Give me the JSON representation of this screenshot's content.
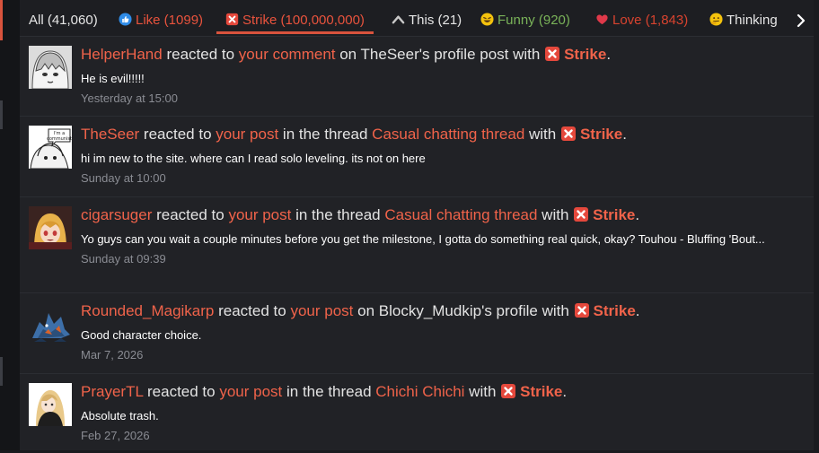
{
  "tabs": [
    {
      "label": "All (41,060)",
      "icon": "none"
    },
    {
      "label": "Like (1099)",
      "icon": "like-icon"
    },
    {
      "label": "Strike (100,000,000)",
      "icon": "strike-icon",
      "active": true
    },
    {
      "label": "This (21)",
      "icon": "this-icon"
    },
    {
      "label": "Funny (920)",
      "icon": "funny-icon"
    },
    {
      "label": "Love (1,843)",
      "icon": "love-icon"
    },
    {
      "label": "Thinking",
      "icon": "thinking-icon"
    }
  ],
  "next_icon": "chevron-right-icon",
  "colors": {
    "accent": "#d9533d",
    "link": "#f0634a",
    "funny": "#7ab359",
    "love": "#d8432f"
  },
  "items": [
    {
      "user": "HelperHand",
      "t1": " reacted to ",
      "link1": "your comment",
      "t2": " on TheSeer's profile post with ",
      "reaction": "Strike",
      "t3": ".",
      "message": "He is evil!!!!!",
      "time": "Yesterday at 15:00"
    },
    {
      "user": "TheSeer",
      "t1": " reacted to ",
      "link1": "your post",
      "t2": " in the thread ",
      "link2": "Casual chatting thread",
      "t2b": " with ",
      "reaction": "Strike",
      "t3": ".",
      "message": "hi im new to the site. where can I read solo leveling. its not on here",
      "time": "Sunday at 10:00",
      "avatar_text": "I'm a communist"
    },
    {
      "user": "cigarsuger",
      "t1": " reacted to ",
      "link1": "your post",
      "t2": " in the thread ",
      "link2": "Casual chatting thread",
      "t2b": " with ",
      "reaction": "Strike",
      "t3": ".",
      "message": "Yo guys can you wait a couple minutes before you get the milestone, I gotta do something real quick, okay? Touhou - Bluffing 'Bout...",
      "time": "Sunday at 09:39"
    },
    {
      "user": "Rounded_Magikarp",
      "t1": " reacted to ",
      "link1": "your post",
      "t2": " on Blocky_Mudkip's profile with ",
      "reaction": "Strike",
      "t3": ".",
      "message": "Good character choice.",
      "time": "Mar 7, 2026"
    },
    {
      "user": "PrayerTL",
      "t1": " reacted to ",
      "link1": "your post",
      "t2": " in the thread ",
      "link2": "Chichi Chichi",
      "t2b": " with ",
      "reaction": "Strike",
      "t3": ".",
      "message": "Absolute trash.",
      "time": "Feb 27, 2026"
    }
  ]
}
